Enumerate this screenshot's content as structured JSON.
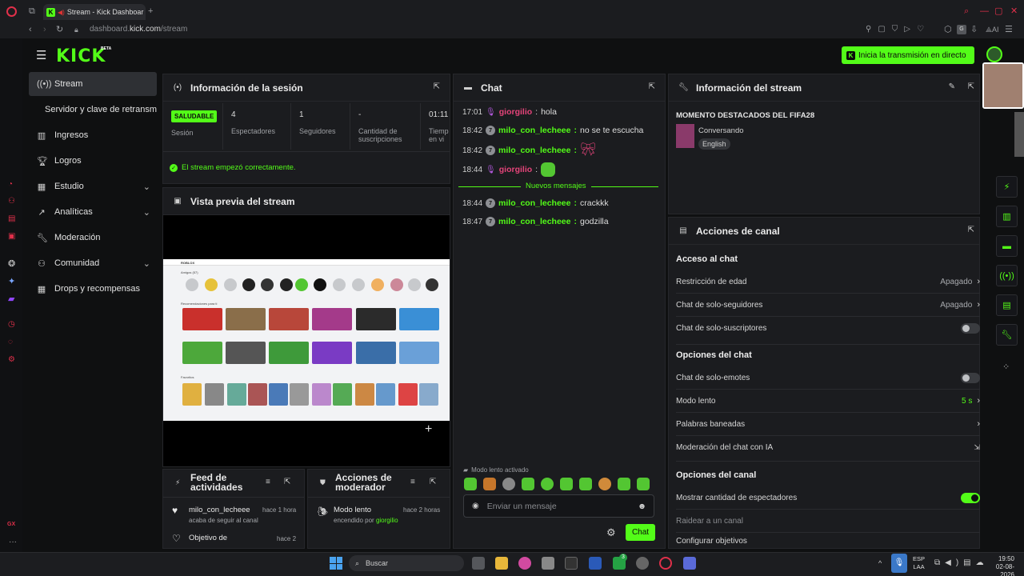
{
  "browser": {
    "tab_title": "Stream - Kick Dashboar",
    "url_prefix": "dashboard.",
    "url_domain": "kick.com",
    "url_path": "/stream",
    "ai_label": "AI"
  },
  "header": {
    "logo": "KICK",
    "beta": "BETA",
    "live_button": "Inicia la transmisión en directo"
  },
  "sidebar": {
    "items": [
      {
        "label": "Stream",
        "icon": "broadcast-icon",
        "active": true
      },
      {
        "label": "Servidor y clave de retransm",
        "icon": "",
        "sub": true
      },
      {
        "label": "Ingresos",
        "icon": "revenue-icon"
      },
      {
        "label": "Logros",
        "icon": "trophy-icon"
      },
      {
        "label": "Estudio",
        "icon": "studio-icon",
        "expandable": true
      },
      {
        "label": "Analíticas",
        "icon": "analytics-icon",
        "expandable": true
      },
      {
        "label": "Moderación",
        "icon": "wrench-icon"
      },
      {
        "label": "Comunidad",
        "icon": "community-icon",
        "expandable": true
      },
      {
        "label": "Drops y recompensas",
        "icon": "drops-icon"
      }
    ]
  },
  "session": {
    "title": "Información de la sesión",
    "status_badge": "SALUDABLE",
    "status_label": "Sesión",
    "viewers_value": "4",
    "viewers_label": "Espectadores",
    "followers_value": "1",
    "followers_label": "Seguidores",
    "subs_value": "-",
    "subs_label_1": "Cantidad de",
    "subs_label_2": "suscripciones",
    "time_value": "01:11",
    "time_label_1": "Tiemp",
    "time_label_2": "en vi",
    "success_msg": "El stream empezó correctamente."
  },
  "preview": {
    "title": "Vista previa del stream",
    "rbx_logo": "ROBLOX",
    "rbx_friends": "Amigos (57)",
    "rbx_recommended": "Recomendaciones para ti",
    "rbx_favorites": "Favoritos"
  },
  "chat": {
    "title": "Chat",
    "messages": [
      {
        "time": "17:01",
        "user": "giorgilio",
        "text": "hola"
      },
      {
        "time": "18:42",
        "user": "milo_con_lecheee",
        "text": "no se te escucha"
      },
      {
        "time": "18:42",
        "user": "milo_con_lecheee",
        "text": ""
      },
      {
        "time": "18:44",
        "user": "giorgilio",
        "text": ""
      },
      {
        "time": "18:44",
        "user": "milo_con_lecheee",
        "text": "crackkk"
      },
      {
        "time": "18:47",
        "user": "milo_con_lecheee",
        "text": "godzilla"
      }
    ],
    "badge": "7",
    "new_messages": "Nuevos mensajes",
    "slow_mode": "Modo lento activado",
    "placeholder": "Enviar un mensaje",
    "send": "Chat"
  },
  "feed": {
    "title_1": "Feed de",
    "title_2": "actividades",
    "item1_user": "milo_con_lecheee",
    "item1_time": "hace 1 hora",
    "item1_desc": "acaba de seguir al canal",
    "item2_title": "Objetivo de",
    "item2_time": "hace 2"
  },
  "modactions": {
    "title_1": "Acciones de",
    "title_2": "moderador",
    "item_title": "Modo lento",
    "item_time": "hace 2 horas",
    "item_desc": "encendido por",
    "item_user": "giorgilio"
  },
  "streaminfo": {
    "title": "Información del stream",
    "stream_title": "MOMENTO DESTACADOS DEL FIFA28",
    "category": "Conversando",
    "language": "English"
  },
  "channel": {
    "title": "Acciones de canal",
    "section1": "Acceso al chat",
    "age": "Restricción de edad",
    "age_val": "Apagado",
    "followers_only": "Chat de solo-seguidores",
    "followers_val": "Apagado",
    "subs_only": "Chat de solo-suscriptores",
    "section2": "Opciones del chat",
    "emotes_only": "Chat de solo-emotes",
    "slow": "Modo lento",
    "slow_val": "5 s",
    "banned": "Palabras baneadas",
    "ai_mod": "Moderación del chat con IA",
    "section3": "Opciones del canal",
    "show_viewers": "Mostrar cantidad de espectadores",
    "raid": "Raidear a un canal",
    "goals": "Configurar objetivos"
  },
  "taskbar": {
    "search": "Buscar",
    "lang": "ESP",
    "layout": "LAA",
    "time": "19:50",
    "date": "02-08-2026",
    "notif": "3"
  },
  "colors": {
    "accent": "#53fc18",
    "panel": "#1b1c1f",
    "bg": "#0f1011",
    "pink": "#e5447a"
  }
}
